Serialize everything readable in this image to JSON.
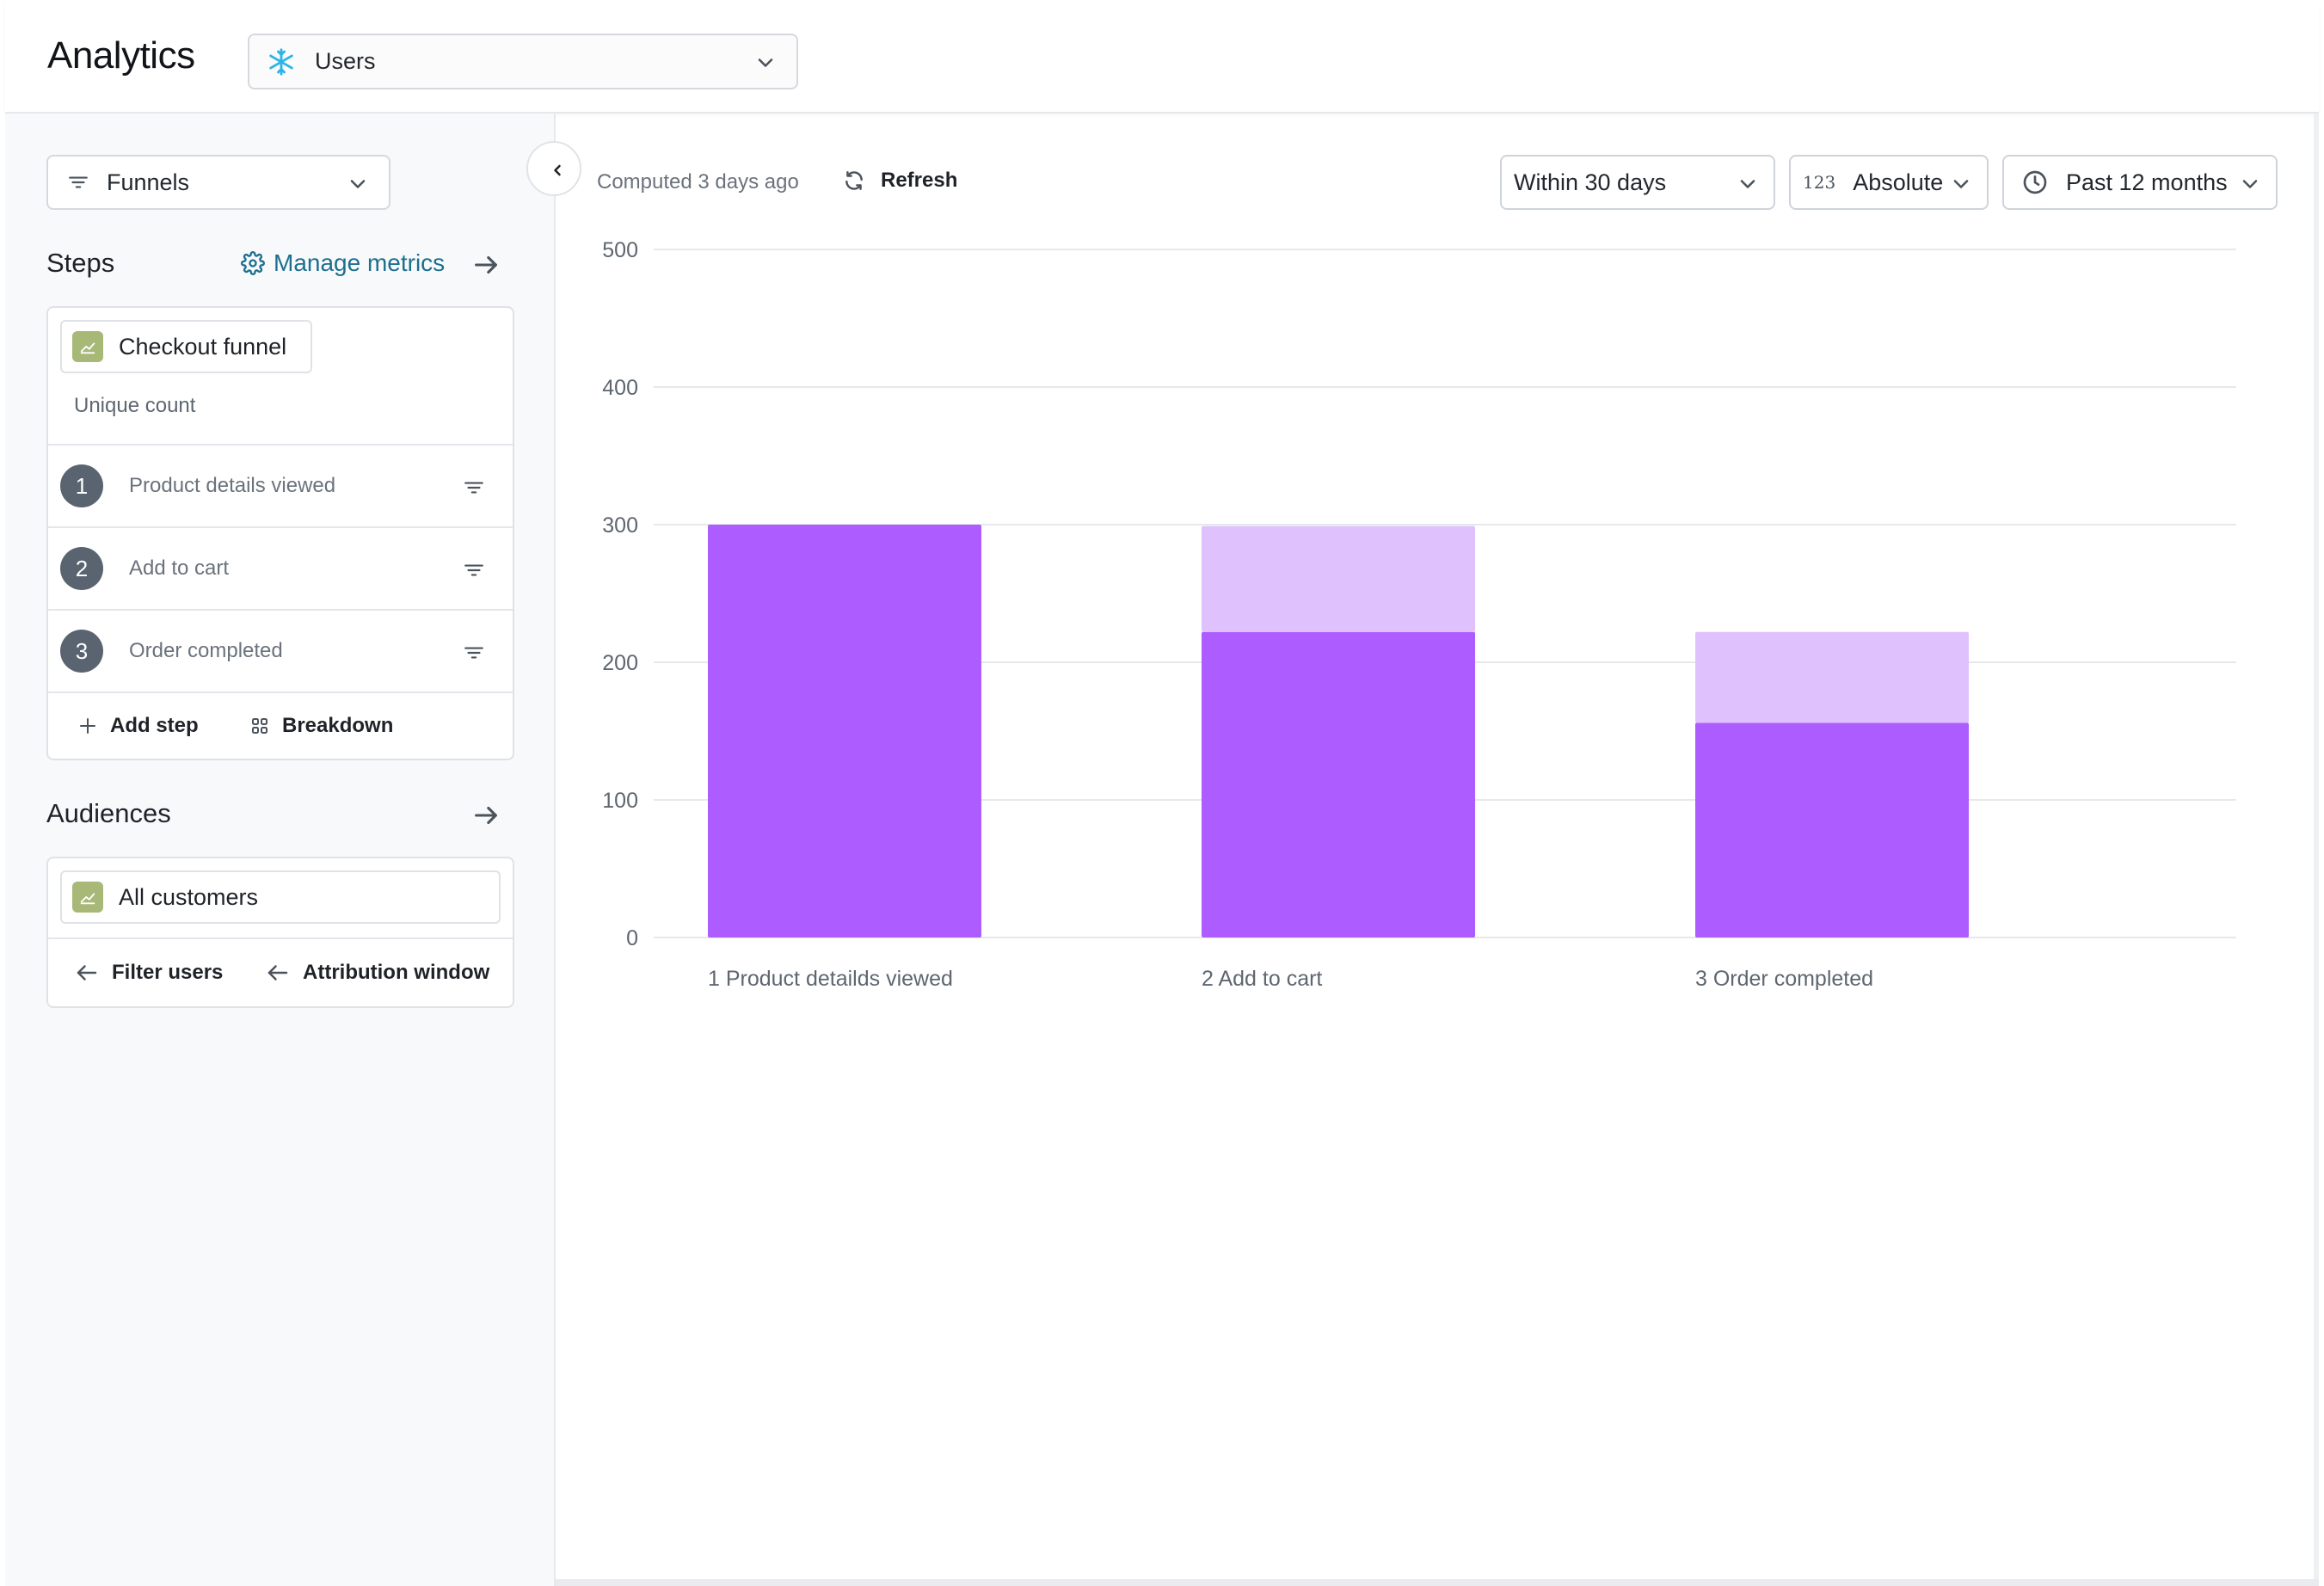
{
  "header": {
    "app_title": "Analytics",
    "source_select": {
      "value": "Users",
      "icon": "snowflake-icon"
    }
  },
  "sidebar": {
    "analysis_type": {
      "value": "Funnels",
      "icon": "filter-lines-icon"
    },
    "steps_section": {
      "title": "Steps",
      "manage_metrics_label": "Manage metrics",
      "metric": {
        "label": "Checkout funnel",
        "subtext": "Unique count"
      },
      "steps": [
        {
          "number": "1",
          "label": "Product details viewed"
        },
        {
          "number": "2",
          "label": "Add to cart"
        },
        {
          "number": "3",
          "label": "Order completed"
        }
      ],
      "add_step_label": "Add step",
      "breakdown_label": "Breakdown"
    },
    "audiences_section": {
      "title": "Audiences",
      "audience": {
        "label": "All customers"
      },
      "filter_users_label": "Filter users",
      "attribution_window_label": "Attribution window"
    }
  },
  "toolbar": {
    "computed_text": "Computed 3 days ago",
    "refresh_label": "Refresh",
    "conversion_window": "Within 30 days",
    "measure_prefix": "123",
    "measure": "Absolute",
    "date_range": "Past 12 months"
  },
  "colors": {
    "bar_converted": "#ad5cff",
    "bar_dropoff": "#dfc2fd",
    "gridline": "#e6e8eb",
    "link": "#1d6f8f",
    "chip_icon": "#a8b877"
  },
  "chart_data": {
    "type": "bar",
    "stacked": true,
    "categories": [
      "1 Product detailds viewed",
      "2 Add to cart",
      "3 Order completed"
    ],
    "series": [
      {
        "values": [
          300,
          222,
          156
        ],
        "color": "#ad5cff"
      },
      {
        "values": [
          0,
          77,
          66
        ],
        "color": "#dfc2fd"
      }
    ],
    "yticks": [
      0,
      100,
      200,
      300,
      400,
      500
    ],
    "ylim": [
      0,
      500
    ],
    "grid": true
  }
}
